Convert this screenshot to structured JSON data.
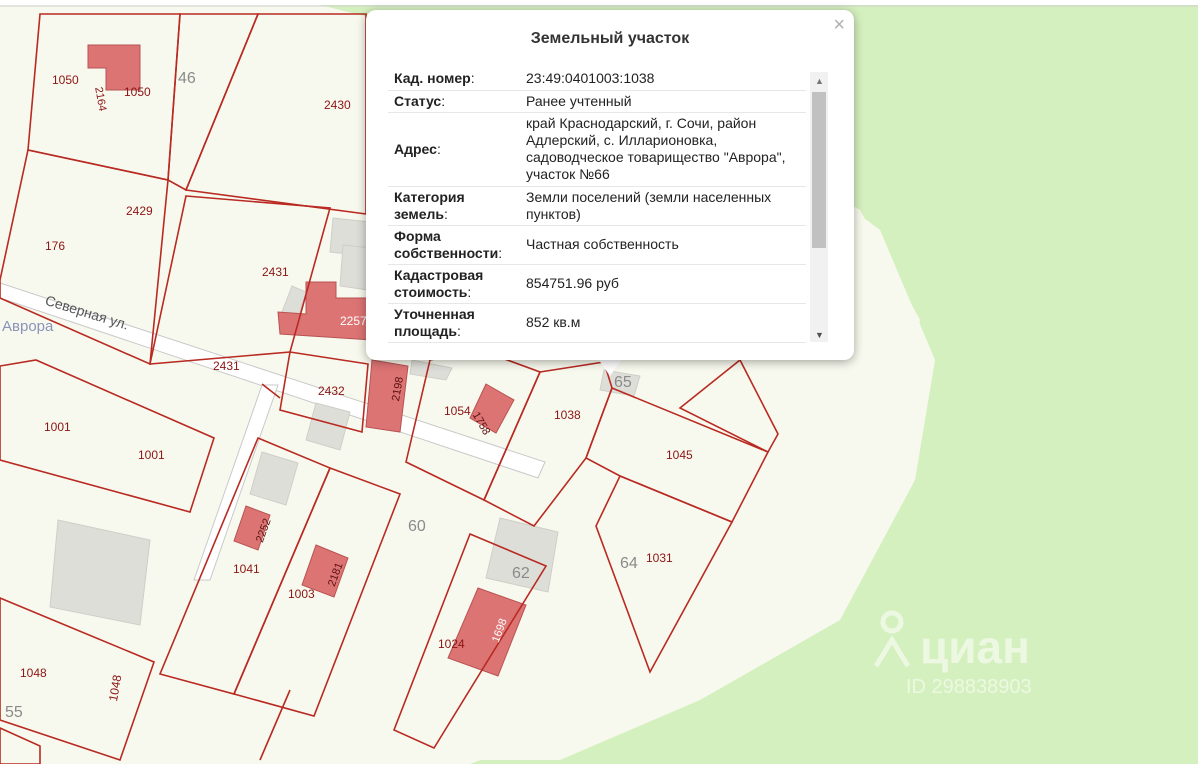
{
  "map": {
    "street_name": "Северная ул.",
    "settlement_name": "Аврора",
    "parcel_labels": [
      "1050",
      "2430",
      "2429",
      "176",
      "2431",
      "2431",
      "2432",
      "1054",
      "1038",
      "1001",
      "1001",
      "1045",
      "1041",
      "1003",
      "1031",
      "1024",
      "1048",
      "1048",
      "2257"
    ],
    "house_numbers": [
      "46",
      "65",
      "60",
      "62",
      "64",
      "55"
    ],
    "building_labels": [
      "2164",
      "1050",
      "2198",
      "1758",
      "2252",
      "2181",
      "1698"
    ],
    "watermark": {
      "brand": "циан",
      "id": "ID 298838903"
    },
    "colors": {
      "land": "#f8f9ee",
      "forest": "#d5f0bf",
      "parcel_border": "#b82a22",
      "building": "#dd7474",
      "building_grey": "#dededa"
    }
  },
  "popup": {
    "title": "Земельный участок",
    "close_symbol": "×",
    "rows": [
      {
        "key": "Кад. номер",
        "value": "23:49:0401003:1038"
      },
      {
        "key": "Статус",
        "value": "Ранее учтенный"
      },
      {
        "key": "Адрес",
        "value": "край Краснодарский, г. Сочи, район Адлерский, с. Илларионовка, садоводческое товарищество \"Аврора\", участок №66"
      },
      {
        "key": "Категория земель",
        "value": "Земли поселений (земли населенных пунктов)"
      },
      {
        "key": "Форма собственности",
        "value": "Частная собственность"
      },
      {
        "key": "Кадастровая стоимость",
        "value": "854751.96 руб"
      },
      {
        "key": "Уточненная площадь",
        "value": "852 кв.м"
      }
    ],
    "scroll_up_symbol": "▲",
    "scroll_down_symbol": "▼"
  }
}
